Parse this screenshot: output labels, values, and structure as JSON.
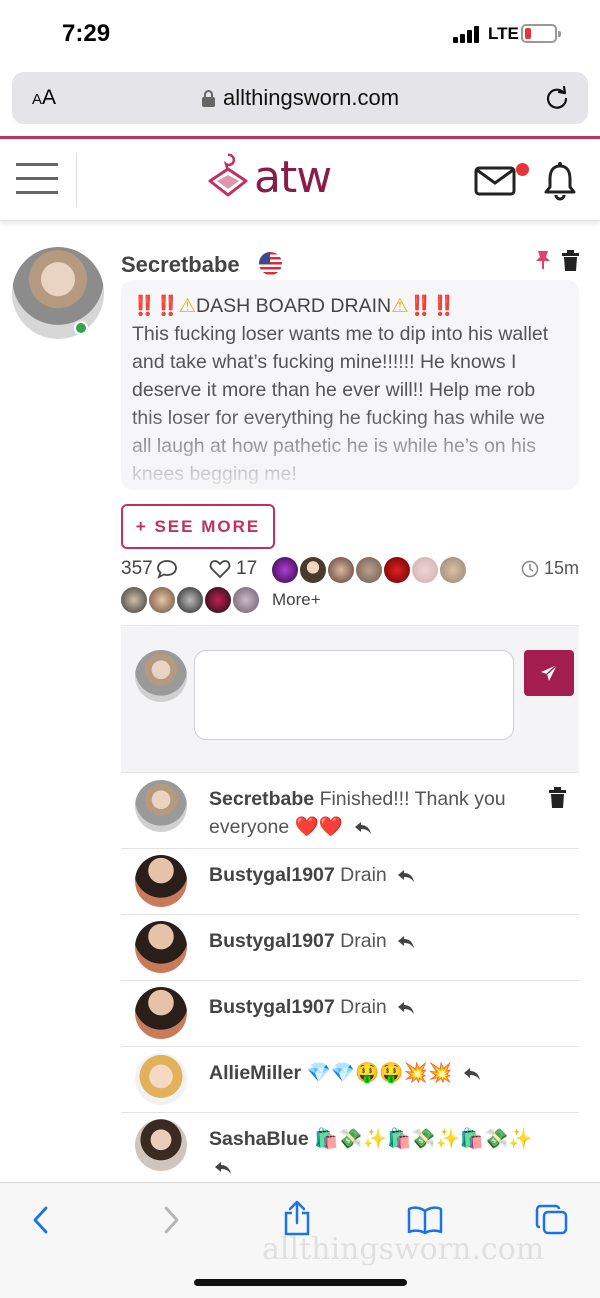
{
  "status_bar": {
    "time": "7:29",
    "network": "LTE"
  },
  "browser": {
    "aa_label_small": "A",
    "aa_label_large": "A",
    "url": "allthingsworn.com"
  },
  "site": {
    "logo": "atw"
  },
  "post": {
    "author": "Secretbabe",
    "title_marks_left": "‼️‼️",
    "title_text": "DASH BOARD DRAIN",
    "title_marks_right": "‼️‼️",
    "body": "This fucking loser wants me to dip into his wallet and take what’s fucking mine!!!!!! He knows I deserve it more than he ever will!! Help me rob this loser for everything he fucking has while we all laugh at how pathetic he is while he’s on his knees begging me!",
    "see_more": "+ SEE MORE",
    "comment_count": "357",
    "like_count": "17",
    "time_ago": "15m",
    "more_label": "More+"
  },
  "comments": [
    {
      "author": "Secretbabe",
      "text": "Finished!!! Thank you everyone ❤️❤️"
    },
    {
      "author": "Bustygal1907",
      "text": "Drain"
    },
    {
      "author": "Bustygal1907",
      "text": "Drain"
    },
    {
      "author": "Bustygal1907",
      "text": "Drain"
    },
    {
      "author": "AllieMiller",
      "text": "💎💎🤑🤑💥💥"
    },
    {
      "author": "SashaBlue",
      "text": "🛍️💸✨🛍️💸✨🛍️💸✨"
    }
  ],
  "watermark": "allthingsworn.com",
  "colors": {
    "brand": "#8a1c47",
    "accent": "#c2305d",
    "send_button": "#a31d4e"
  }
}
